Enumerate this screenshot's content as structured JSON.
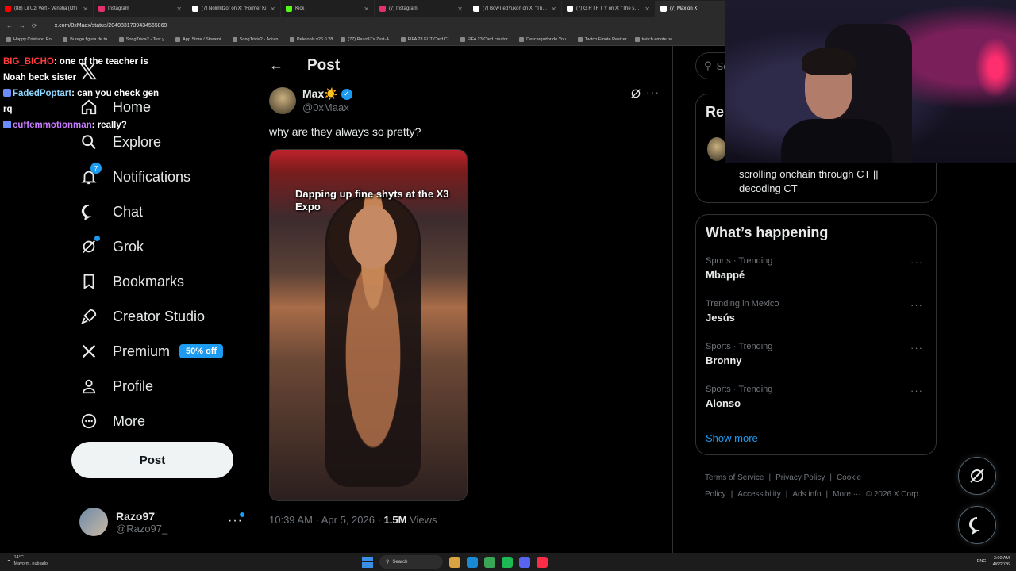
{
  "browser": {
    "tabs": [
      {
        "title": "(88) Lil Uzi Vert - Venetia [Offi",
        "color": "#ff0000"
      },
      {
        "title": "Instagram",
        "color": "#e1306c"
      },
      {
        "title": "(7) Nolimitzor on X: \"Former Ki",
        "color": "#ffffff"
      },
      {
        "title": "Kick",
        "color": "#53fc18"
      },
      {
        "title": "(7) Instagram",
        "color": "#e1306c"
      },
      {
        "title": "(7) BowTiedYukon on X: \"The c",
        "color": "#ffffff"
      },
      {
        "title": "(7) G R I F T Y on X: \"The self tr",
        "color": "#ffffff"
      },
      {
        "title": "(7) Max on X",
        "color": "#ffffff"
      }
    ],
    "url": "x.com/0xMaax/status/2040831739434565869",
    "bookmarks": [
      "Happy Cristiano Ro...",
      "Burego figura de tu...",
      "SongTrivia2 - Test y...",
      "App Store / Streami...",
      "SongTrivia2 - Adivin...",
      "Peletools v26.0.28",
      "(77) Razo97's Zest-A...",
      "FIFA 23 FUT Card Cr...",
      "FIFA 23 Card creator...",
      "Descargador de You...",
      "Twitch Emote Resizer",
      "twitch emote re"
    ]
  },
  "chat": [
    {
      "user": "BIG_BICHO",
      "color": "#ff3b3b",
      "text": ": one of the teacher is Noah beck sister"
    },
    {
      "user": "FadedPoptart",
      "color": "#8fd6ff",
      "text": ": can you check gen rq"
    },
    {
      "user": "cuffemmotionman",
      "color": "#c77dff",
      "text": ": really?"
    }
  ],
  "nav": {
    "items": [
      {
        "label": "Home",
        "icon": "home-icon"
      },
      {
        "label": "Explore",
        "icon": "search-icon"
      },
      {
        "label": "Notifications",
        "icon": "bell-icon",
        "badge": "7"
      },
      {
        "label": "Chat",
        "icon": "chat-icon"
      },
      {
        "label": "Grok",
        "icon": "grok-icon"
      },
      {
        "label": "Bookmarks",
        "icon": "bookmark-icon"
      },
      {
        "label": "Creator Studio",
        "icon": "rocket-icon"
      },
      {
        "label": "Premium",
        "icon": "x-icon",
        "badge": "50% off"
      },
      {
        "label": "Profile",
        "icon": "person-icon"
      },
      {
        "label": "More",
        "icon": "more-circle-icon"
      }
    ],
    "post_button": "Post",
    "account": {
      "name": "Razo97",
      "handle": "@Razo97_"
    }
  },
  "post": {
    "header": "Post",
    "author_name": "Max☀️",
    "author_handle": "@0xMaax",
    "text": "why are they always so pretty?",
    "media_caption": "Dapping up fine shyts at the X3 Expo",
    "timestamp": "10:39 AM · Apr 5, 2026 · ",
    "views_count": "1.5M",
    "views_label": " Views"
  },
  "sidebar": {
    "search_placeholder": "Se",
    "relevant_title": "Rel",
    "relevant_bio": "scrolling onchain through CT || decoding CT",
    "happening_title": "What’s happening",
    "trends": [
      {
        "context": "Sports · Trending",
        "name": "Mbappé"
      },
      {
        "context": "Trending in Mexico",
        "name": "Jesús"
      },
      {
        "context": "Sports · Trending",
        "name": "Bronny"
      },
      {
        "context": "Sports · Trending",
        "name": "Alonso"
      }
    ],
    "show_more": "Show more",
    "footer": [
      "Terms of Service",
      "|",
      "Privacy Policy",
      "|",
      "Cookie Policy",
      "|",
      "Accessibility",
      "|",
      "Ads info",
      "|",
      "More ···",
      "© 2026 X Corp."
    ]
  },
  "taskbar": {
    "weather_temp": "14°C",
    "weather_desc": "Mayorm. nublado",
    "search": "Search",
    "lang": "ENG",
    "time": "3:00 AM",
    "date": "4/6/2026"
  }
}
